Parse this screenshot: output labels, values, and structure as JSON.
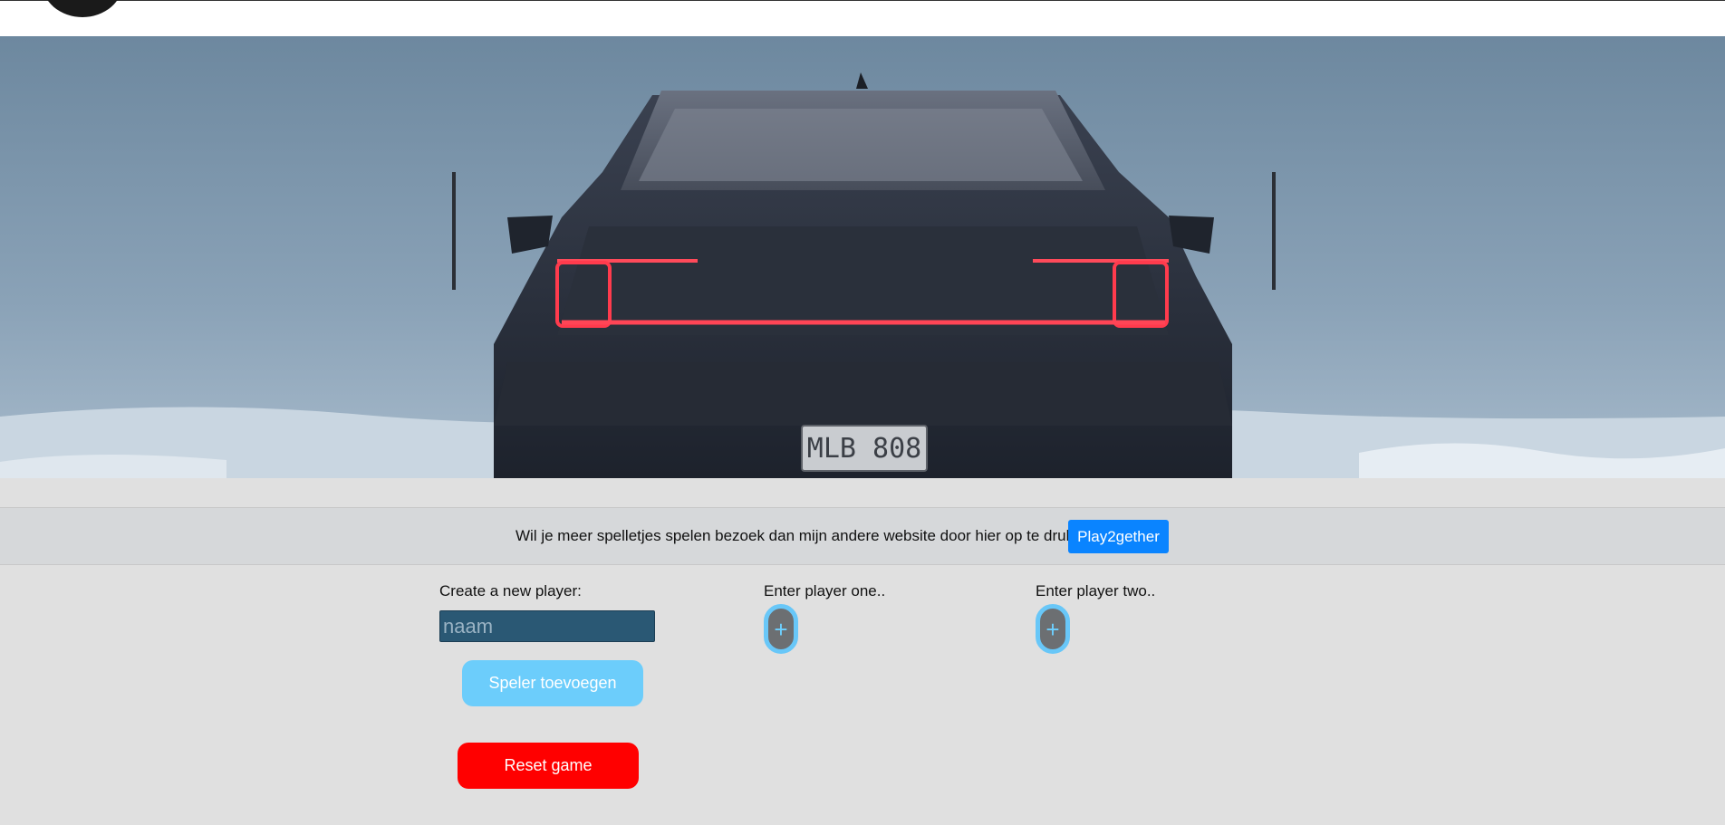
{
  "banner": {
    "text": "Wil je meer spelletjes spelen bezoek dan mijn andere website door hier op te drukken",
    "button_label": "Play2gether"
  },
  "create_player": {
    "label": "Create a new player:",
    "input_placeholder": "naam",
    "input_value": "",
    "add_button_label": "Speler toevoegen"
  },
  "player_one": {
    "label": "Enter player one..",
    "add_icon": "+"
  },
  "player_two": {
    "label": "Enter player two..",
    "add_icon": "+"
  },
  "reset_button_label": "Reset game",
  "hero_image": {
    "license_plate": "MLB 808"
  },
  "colors": {
    "play_button": "#0a84ff",
    "add_player_button": "#6ccdfb",
    "reset_button": "#ff0000",
    "input_bg": "#2a5874",
    "plus_border": "#68c7f8"
  }
}
